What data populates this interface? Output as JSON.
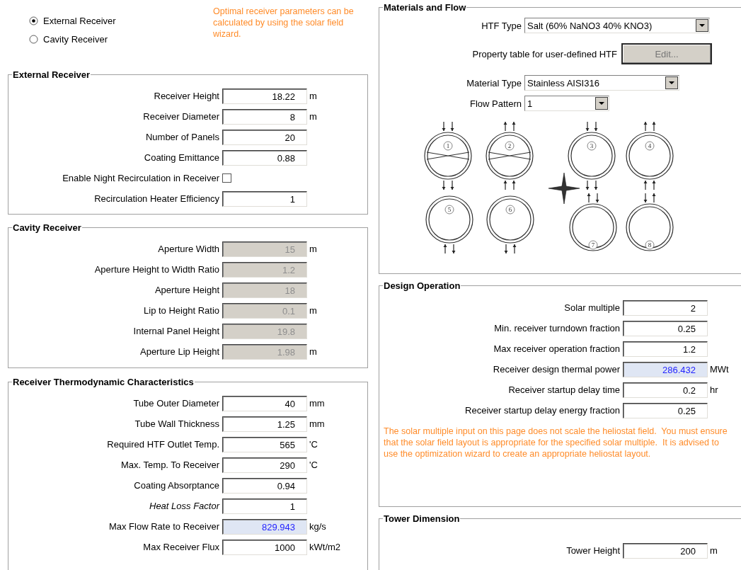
{
  "receiver_type": [
    {
      "label": "External Receiver",
      "selected": true
    },
    {
      "label": "Cavity Receiver",
      "selected": false
    }
  ],
  "hint": "Optimal receiver parameters can be calculated by using the solar field wizard.",
  "external_receiver": {
    "title": "External Receiver",
    "disabled": false,
    "rows": [
      {
        "kind": "input",
        "label": "Receiver Height",
        "value": "18.22",
        "unit": "m"
      },
      {
        "kind": "input",
        "label": "Receiver Diameter",
        "value": "8",
        "unit": "m"
      },
      {
        "kind": "input",
        "label": "Number of Panels",
        "value": "20"
      },
      {
        "kind": "input",
        "label": "Coating Emittance",
        "value": "0.88"
      },
      {
        "kind": "checkbox",
        "label": "Enable Night Recirculation in Receiver",
        "checked": false
      },
      {
        "kind": "input",
        "label": "Recirculation Heater Efficiency",
        "value": "1"
      }
    ]
  },
  "cavity_receiver": {
    "title": "Cavity Receiver",
    "disabled": true,
    "rows": [
      {
        "kind": "input",
        "label": "Aperture Width",
        "value": "15",
        "unit": "m"
      },
      {
        "kind": "input",
        "label": "Aperture Height to Width Ratio",
        "value": "1.2"
      },
      {
        "kind": "input",
        "label": "Aperture Height",
        "value": "18"
      },
      {
        "kind": "input",
        "label": "Lip to Height Ratio",
        "value": "0.1",
        "unit": "m"
      },
      {
        "kind": "input",
        "label": "Internal Panel Height",
        "value": "19.8"
      },
      {
        "kind": "input",
        "label": "Aperture Lip Height",
        "value": "1.98",
        "unit": "m"
      }
    ]
  },
  "thermodynamic": {
    "title": "Receiver Thermodynamic Characteristics",
    "disabled": false,
    "rows": [
      {
        "kind": "input",
        "label": "Tube Outer Diameter",
        "value": "40",
        "unit": "mm"
      },
      {
        "kind": "input",
        "label": "Tube Wall Thickness",
        "value": "1.25",
        "unit": "mm"
      },
      {
        "kind": "input",
        "label": "Required HTF Outlet Temp.",
        "value": "565",
        "unit": "'C"
      },
      {
        "kind": "input",
        "label": "Max. Temp. To Receiver",
        "value": "290",
        "unit": "'C"
      },
      {
        "kind": "input",
        "label": "Coating Absorptance",
        "value": "0.94"
      },
      {
        "kind": "input",
        "label": "Heat Loss Factor",
        "value": "1",
        "italic": true
      },
      {
        "kind": "output",
        "label": "Max Flow Rate to Receiver",
        "value": "829.943",
        "unit": "kg/s"
      },
      {
        "kind": "input",
        "label": "Max Receiver Flux",
        "value": "1000",
        "unit": "kWt/m2"
      }
    ]
  },
  "materials_and_flow": {
    "title": "Materials and Flow",
    "rows": [
      {
        "kind": "dropdown",
        "label": "HTF Type",
        "value": "Salt (60% NaNO3 40% KNO3)"
      },
      {
        "kind": "button",
        "label": "Property table for user-defined HTF",
        "value": "Edit...",
        "disabled": true
      },
      {
        "kind": "dropdown",
        "label": "Material Type",
        "value": "Stainless AISI316"
      },
      {
        "kind": "dropdown",
        "label": "Flow Pattern",
        "value": "1"
      }
    ],
    "flow_patterns": [
      "1",
      "2",
      "3",
      "4",
      "5",
      "6",
      "7",
      "8"
    ]
  },
  "design_operation": {
    "title": "Design Operation",
    "disabled": false,
    "rows": [
      {
        "kind": "input",
        "label": "Solar multiple",
        "value": "2"
      },
      {
        "kind": "input",
        "label": "Min. receiver turndown fraction",
        "value": "0.25"
      },
      {
        "kind": "input",
        "label": "Max receiver operation fraction",
        "value": "1.2"
      },
      {
        "kind": "output",
        "label": "Receiver design thermal power",
        "value": "286.432",
        "unit": "MWt"
      },
      {
        "kind": "input",
        "label": "Receiver startup delay time",
        "value": "0.2",
        "unit": "hr"
      },
      {
        "kind": "input",
        "label": "Receiver startup delay energy fraction",
        "value": "0.25"
      }
    ],
    "note": "The solar multiple input on this page does not scale the heliostat field.  You must ensure that the solar field layout is appropriate for the specified solar multiple.  It is advised to use the optimization wizard to create an appropriate heliostat layout."
  },
  "tower_dimension": {
    "title": "Tower Dimension",
    "disabled": false,
    "rows": [
      {
        "kind": "input",
        "label": "Tower Height",
        "value": "200",
        "unit": "m"
      }
    ]
  }
}
